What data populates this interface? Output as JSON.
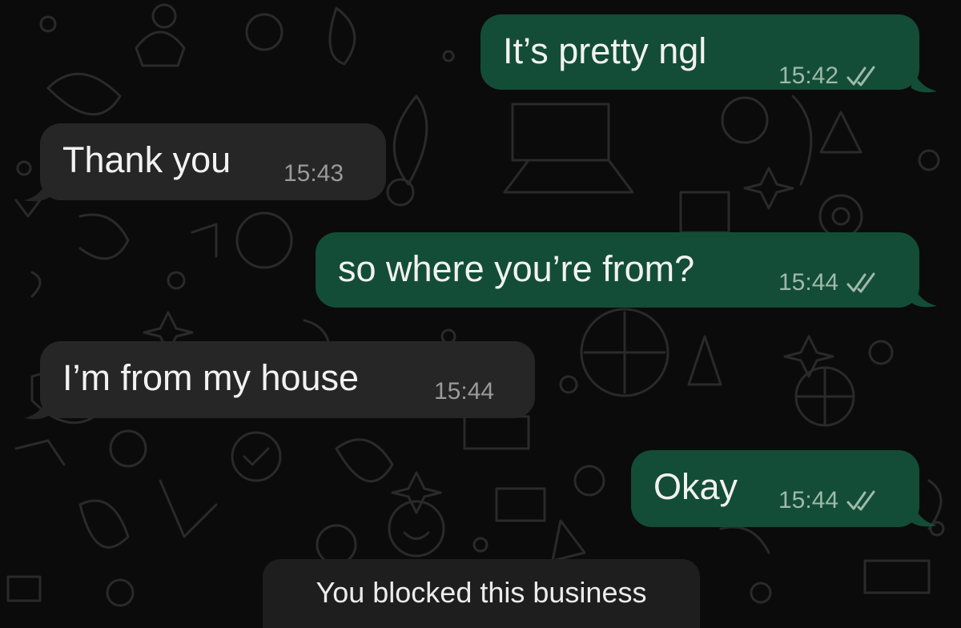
{
  "messages": [
    {
      "direction": "outgoing",
      "text": "It’s pretty ngl",
      "time": "15:42",
      "status": "read-double-check-icon"
    },
    {
      "direction": "incoming",
      "text": "Thank you",
      "time": "15:43"
    },
    {
      "direction": "outgoing",
      "text": "so where you’re from?",
      "time": "15:44",
      "status": "read-double-check-icon"
    },
    {
      "direction": "incoming",
      "text": "I’m from my house",
      "time": "15:44"
    },
    {
      "direction": "outgoing",
      "text": "Okay",
      "time": "15:44",
      "status": "read-double-check-icon"
    }
  ],
  "system_notice": "You blocked this business",
  "colors": {
    "background": "#0b0b0b",
    "outgoing_bubble": "#134d37",
    "incoming_bubble": "#262626",
    "notice_bg": "#1e1e1e"
  }
}
